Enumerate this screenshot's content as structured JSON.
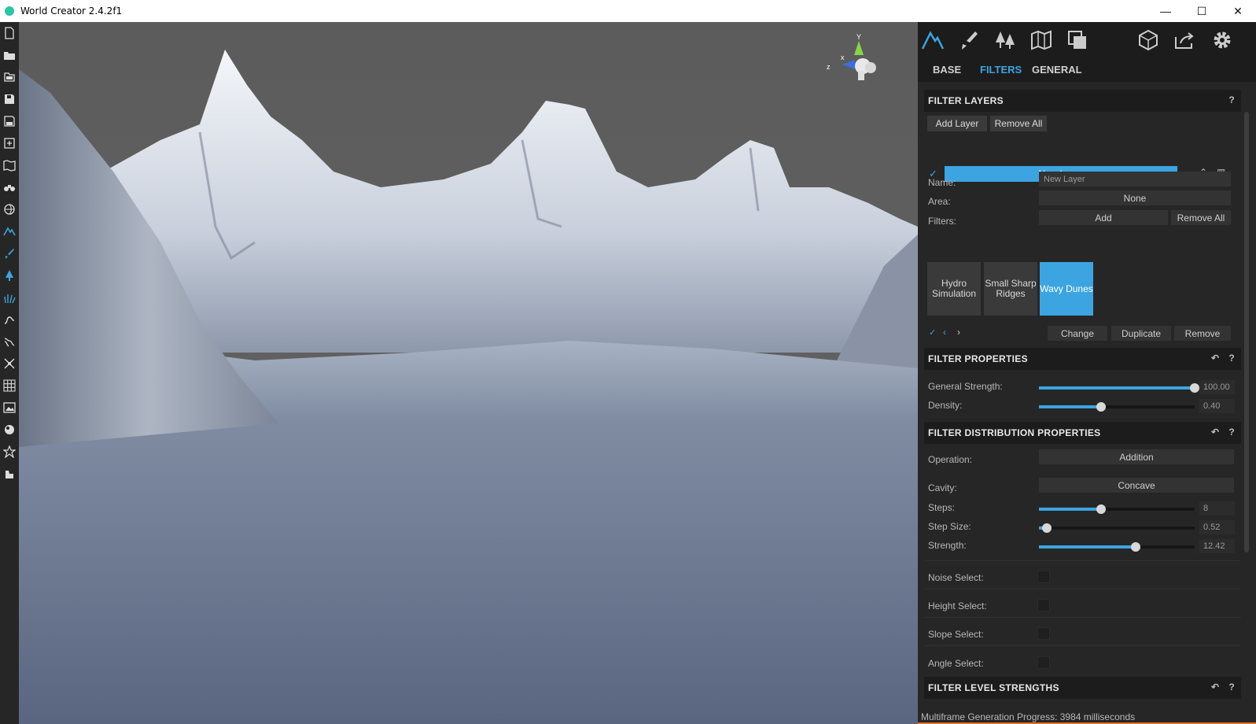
{
  "window": {
    "title": "World Creator 2.4.2f1",
    "minimize": "—",
    "maximize": "☐",
    "close": "✕"
  },
  "left_tools": [
    "new-file",
    "open-folder",
    "open-recent",
    "save",
    "save-as",
    "import",
    "terrain-map",
    "binoculars",
    "globe",
    "mountain",
    "brush",
    "tree",
    "grass",
    "path",
    "river",
    "transform",
    "grid",
    "image",
    "sphere",
    "star",
    "bulldozer"
  ],
  "panel": {
    "top_icons": [
      "mountain-icon",
      "brush-icon",
      "trees-icon",
      "map-icon",
      "layers-icon",
      "cube-icon",
      "export-icon",
      "gear-icon"
    ],
    "tabs": [
      {
        "label": "BASE",
        "active": false
      },
      {
        "label": "FILTERS",
        "active": true
      },
      {
        "label": "GENERAL",
        "active": false
      }
    ],
    "filter_layers": {
      "title": "FILTER LAYERS",
      "help": "?",
      "add_layer": "Add Layer",
      "remove_all": "Remove All",
      "layer_name": "New Layer",
      "name_label": "Name:",
      "name_value": "New Layer",
      "area_label": "Area:",
      "area_value": "None",
      "filters_label": "Filters:",
      "filters_add": "Add",
      "filters_remove_all": "Remove All",
      "chips": [
        {
          "label": "Hydro Simulation",
          "active": false
        },
        {
          "label": "Small Sharp Ridges",
          "active": false
        },
        {
          "label": "Wavy Dunes",
          "active": true
        }
      ],
      "change": "Change",
      "duplicate": "Duplicate",
      "remove": "Remove"
    },
    "filter_properties": {
      "title": "FILTER PROPERTIES",
      "general_strength_label": "General Strength:",
      "general_strength_value": "100.00",
      "general_strength_frac": 1.0,
      "density_label": "Density:",
      "density_value": "0.40",
      "density_frac": 0.4
    },
    "filter_distribution": {
      "title": "FILTER DISTRIBUTION PROPERTIES",
      "operation_label": "Operation:",
      "operation_value": "Addition",
      "cavity_label": "Cavity:",
      "cavity_value": "Concave",
      "steps_label": "Steps:",
      "steps_value": "8",
      "steps_frac": 0.4,
      "step_size_label": "Step Size:",
      "step_size_value": "0.52",
      "step_size_frac": 0.05,
      "strength_label": "Strength:",
      "strength_value": "12.42",
      "strength_frac": 0.62,
      "noise_select": "Noise Select:",
      "height_select": "Height Select:",
      "slope_select": "Slope Select:",
      "angle_select": "Angle Select:"
    },
    "filter_level_strengths": {
      "title": "FILTER LEVEL STRENGTHS"
    },
    "status": "Multiframe Generation Progress: 3984 milliseconds"
  },
  "gizmo": {
    "y": "Y",
    "x": "x",
    "z": "z"
  },
  "colors": {
    "accent": "#3ca4e0",
    "panel_bg": "#262626",
    "header_bg": "#1c1c1c",
    "progress": "#e0702a"
  }
}
